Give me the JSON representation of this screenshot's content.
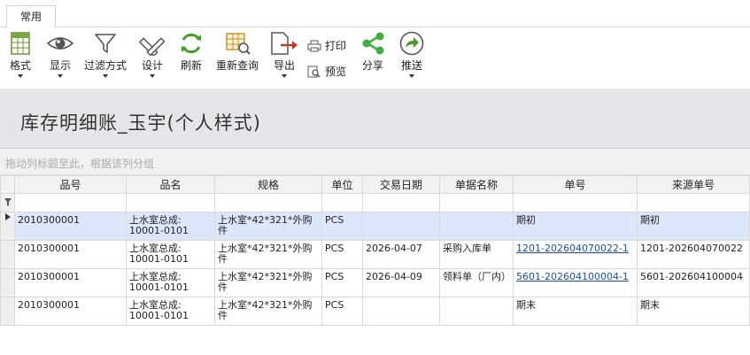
{
  "tabs": [
    {
      "label": "常用"
    }
  ],
  "toolbar": {
    "format": {
      "label": "格式",
      "icon": "spreadsheet-icon"
    },
    "display": {
      "label": "显示",
      "icon": "eye-icon"
    },
    "filter_mode": {
      "label": "过滤方式",
      "icon": "filter-icon"
    },
    "design": {
      "label": "设计",
      "icon": "design-tools-icon"
    },
    "refresh": {
      "label": "刷新",
      "icon": "refresh-icon"
    },
    "requery": {
      "label": "重新查询",
      "icon": "table-search-icon"
    },
    "export": {
      "label": "导出",
      "icon": "export-icon"
    },
    "print": {
      "label": "打印",
      "icon": "printer-icon"
    },
    "preview": {
      "label": "预览",
      "icon": "preview-icon"
    },
    "share": {
      "label": "分享",
      "icon": "share-icon"
    },
    "push": {
      "label": "推送",
      "icon": "push-icon"
    }
  },
  "page": {
    "title": "库存明细账_玉宇(个人样式)"
  },
  "grid": {
    "group_hint": "拖动列标题至此，根据该列分组",
    "columns": [
      "品号",
      "品名",
      "规格",
      "单位",
      "交易日期",
      "单据名称",
      "单号",
      "来源单号"
    ],
    "rows": [
      {
        "item_no": "2010300001",
        "item_name": "上水室总成: 10001-0101",
        "spec": "上水室*42*321*外购件",
        "unit": "PCS",
        "date": "",
        "doc_name": "",
        "doc_no": "期初",
        "source_no": "期初"
      },
      {
        "item_no": "2010300001",
        "item_name": "上水室总成: 10001-0101",
        "spec": "上水室*42*321*外购件",
        "unit": "PCS",
        "date": "2026-04-07",
        "doc_name": "采购入库单",
        "doc_no": "1201-202604070022-1",
        "source_no": "1201-202604070022"
      },
      {
        "item_no": "2010300001",
        "item_name": "上水室总成: 10001-0101",
        "spec": "上水室*42*321*外购件",
        "unit": "PCS",
        "date": "2026-04-09",
        "doc_name": "领料单（厂内）",
        "doc_no": "5601-202604100004-1",
        "source_no": "5601-202604100004"
      },
      {
        "item_no": "2010300001",
        "item_name": "上水室总成: 10001-0101",
        "spec": "上水室*42*321*外购件",
        "unit": "PCS",
        "date": "",
        "doc_name": "",
        "doc_no": "期末",
        "source_no": "期末"
      }
    ]
  },
  "colors": {
    "accent": "#1d4f9c",
    "selected_row": "#dde7fb",
    "title_bg": "#e4e6ea"
  }
}
